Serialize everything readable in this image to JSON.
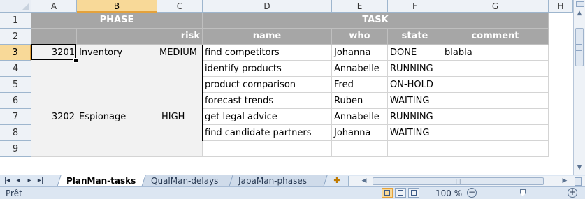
{
  "columns": [
    "A",
    "B",
    "C",
    "D",
    "E",
    "F",
    "G",
    "H"
  ],
  "rows": [
    "1",
    "2",
    "3",
    "4",
    "5",
    "6",
    "7",
    "8",
    "9"
  ],
  "header": {
    "phase": "PHASE",
    "task": "TASK",
    "risk": "risk",
    "name": "name",
    "who": "who",
    "state": "state",
    "comment": "comment"
  },
  "data_rows": [
    {
      "id": "3201",
      "phase": "Inventory",
      "risk": "MEDIUM",
      "name": "find competitors",
      "who": "Johanna",
      "state": "DONE",
      "comment": "blabla"
    },
    {
      "id": "",
      "phase": "",
      "risk": "",
      "name": "identify products",
      "who": "Annabelle",
      "state": "RUNNING",
      "comment": ""
    },
    {
      "id": "",
      "phase": "",
      "risk": "",
      "name": "product comparison",
      "who": "Fred",
      "state": "ON-HOLD",
      "comment": ""
    },
    {
      "id": "",
      "phase": "",
      "risk": "",
      "name": "forecast trends",
      "who": "Ruben",
      "state": "WAITING",
      "comment": ""
    },
    {
      "id": "3202",
      "phase": "Espionage",
      "risk": "HIGH",
      "name": "get legal advice",
      "who": "Annabelle",
      "state": "RUNNING",
      "comment": ""
    },
    {
      "id": "",
      "phase": "",
      "risk": "",
      "name": "find candidate partners",
      "who": "Johanna",
      "state": "WAITING",
      "comment": ""
    }
  ],
  "sheet_tabs": [
    "PlanMan-tasks",
    "QualMan-delays",
    "JapaMan-phases"
  ],
  "active_tab": "PlanMan-tasks",
  "status": "Prêt",
  "zoom": "100 %",
  "colors": {
    "header_dark": "#a6a6a6",
    "phase_fill": "#f2f2f2",
    "selection": "#f8d998"
  }
}
